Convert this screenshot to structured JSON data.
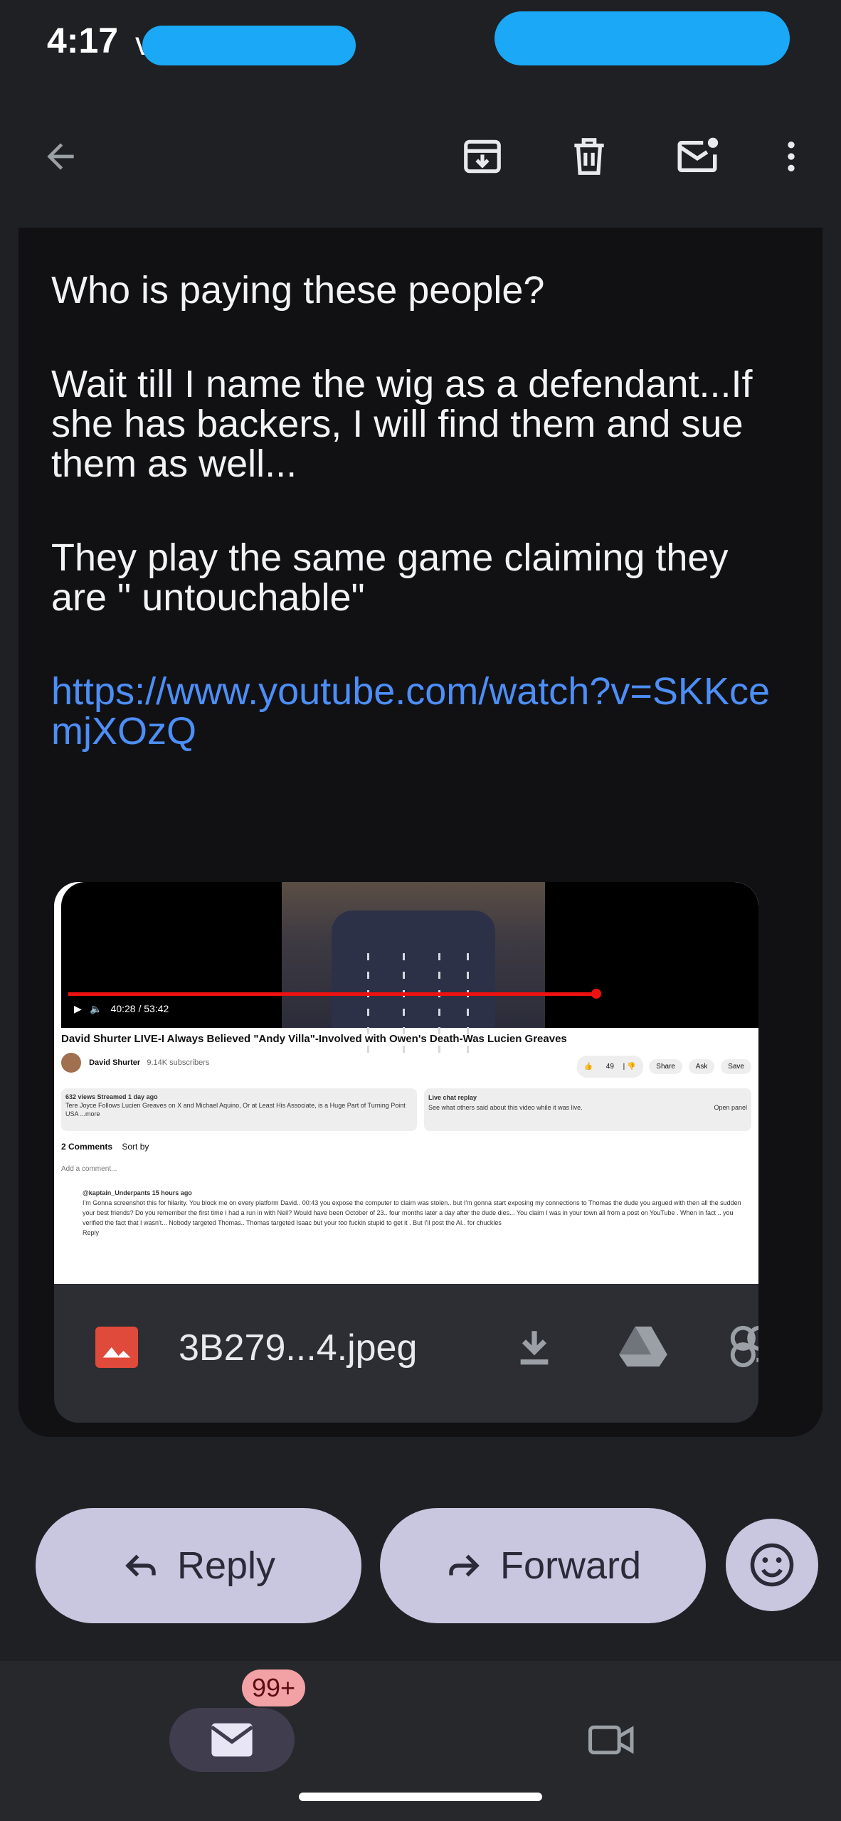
{
  "status_bar": {
    "time": "4:17",
    "partial_text": "v"
  },
  "toolbar": {
    "back_icon": "arrow-back-icon",
    "archive_icon": "archive-icon",
    "delete_icon": "trash-icon",
    "mark_unread_icon": "mail-unread-icon",
    "more_icon": "more-vert-icon"
  },
  "message": {
    "paragraphs": [
      "Who is paying these people?",
      "Wait till I name the wig as a defendant...If she has backers, I will find them and sue them as well...",
      "They play the same game claiming they are \" untouchable\""
    ],
    "link": "https://www.youtube.com/watch?v=SKKcemjXOzQ"
  },
  "attachment": {
    "file_name": "3B279...4.jpeg",
    "file_icon": "image-file-icon",
    "download_icon": "download-icon",
    "drive_icon": "google-drive-icon",
    "photos_icon": "add-to-photos-icon",
    "thumbnail": {
      "video_time": "40:28 / 53:42",
      "video_title": "David Shurter LIVE-I Always Believed \"Andy Villa\"-Involved with Owen's Death-Was Lucien Greaves",
      "channel": "David Shurter",
      "subscribers": "9.14K subscribers",
      "like_count": "49",
      "share_label": "Share",
      "ask_label": "Ask",
      "save_label": "Save",
      "views": "632 views  Streamed 1 day ago",
      "description": "Tere Joyce Follows Lucien Greaves on X and Michael Aquino, Or at Least His Associate, is a Huge Part of Turning Point USA  ...more",
      "live_chat_title": "Live chat replay",
      "live_chat_text": "See what others said about this video while it was live.",
      "open_panel": "Open panel",
      "comments_count": "2 Comments",
      "sort_by": "Sort by",
      "add_comment": "Add a comment...",
      "commenter": "@kaptain_Underpants  15 hours ago",
      "comment_text": "I'm Gonna screenshot this for hilarity. You block me on every platform David.. 00:43 you expose the computer to claim was stolen.. but I'm gonna start exposing my connections to Thomas the dude you argued with then all the sudden your best friends? Do you remember the first time I had a run in with Neil? Would have been October of 23.. four months later a day after the dude dies... You claim I was in your town all from a post on YouTube . When in fact .. you verified the fact that I wasn't... Nobody targeted Thomas.. Thomas targeted Isaac but your too fuckin stupid to get it . But I'll post the AI.. for chuckles",
      "reply_label": "Reply"
    }
  },
  "actions": {
    "reply_label": "Reply",
    "forward_label": "Forward",
    "emoji_icon": "emoji-smile-icon"
  },
  "bottom_nav": {
    "mail_icon": "mail-icon",
    "badge": "99+",
    "meet_icon": "video-camera-icon"
  },
  "colors": {
    "link": "#4d8ef7",
    "pill": "#c9c6e0",
    "badge": "#f2a1a4"
  }
}
